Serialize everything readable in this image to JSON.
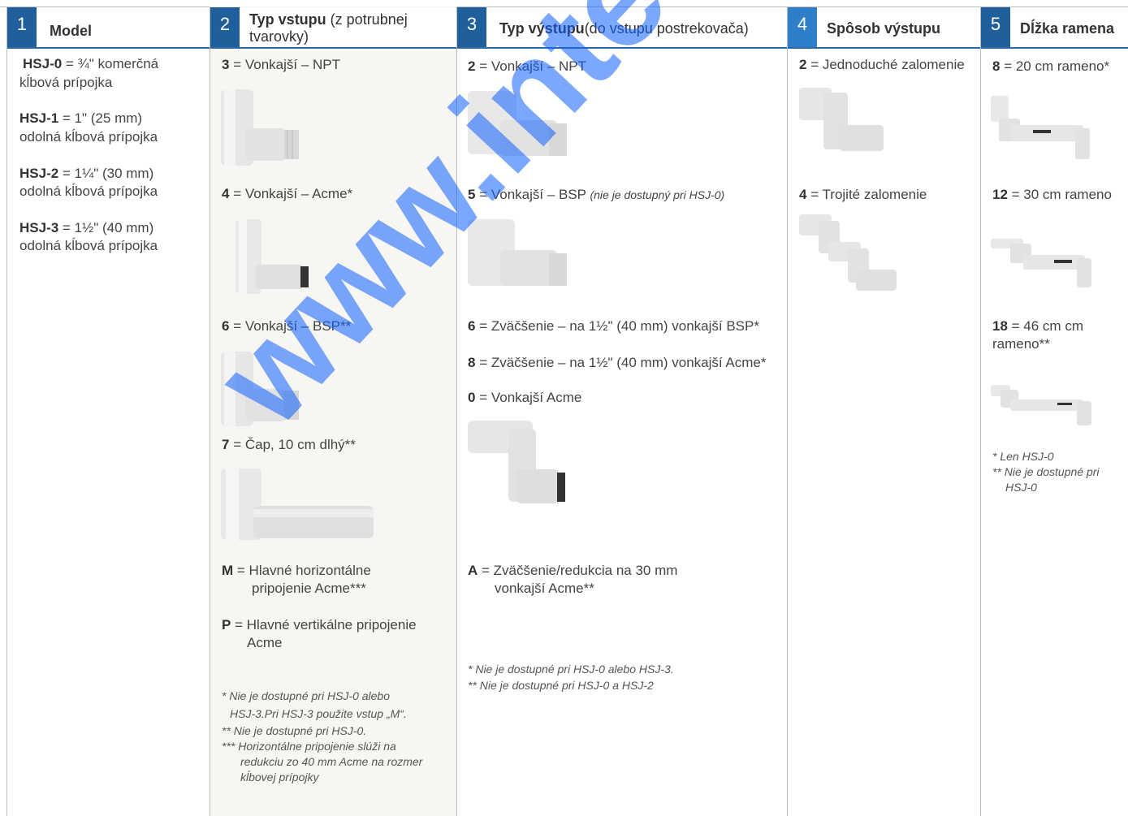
{
  "watermark": "www.intersad.sk",
  "columns": [
    {
      "number": "1",
      "title": "Model",
      "subtitle": ""
    },
    {
      "number": "2",
      "title": "Typ vstupu",
      "subtitle": " (z potrubnej tvarovky)"
    },
    {
      "number": "3",
      "title": "Typ výstupu",
      "subtitle": " (do vstupu postrekovača)"
    },
    {
      "number": "4",
      "title": "Spôsob výstupu",
      "subtitle": ""
    },
    {
      "number": "5",
      "title": "Dĺžka ramena",
      "subtitle": ""
    }
  ],
  "model": [
    {
      "code": "HSJ-0",
      "line1": " = ¾\" komerčná",
      "line2": "kĺbová prípojka"
    },
    {
      "code": "HSJ-1",
      "line1": " = 1\" (25 mm)",
      "line2": "odolná kĺbová prípojka"
    },
    {
      "code": "HSJ-2",
      "line1": " = 1¼\" (30 mm)",
      "line2": "odolná kĺbová prípojka"
    },
    {
      "code": "HSJ-3",
      "line1": " = 1½\" (40 mm)",
      "line2": "odolná kĺbová prípojka"
    }
  ],
  "inlet": {
    "items": [
      {
        "code": "3",
        "text": " = Vonkajší – NPT"
      },
      {
        "code": "4",
        "text": " = Vonkajší – Acme*"
      },
      {
        "code": "6",
        "text": " = Vonkajší – BSP**"
      },
      {
        "code": "7",
        "text": " = Čap, 10 cm dlhý**"
      }
    ],
    "M": {
      "code": "M",
      "line1": " = Hlavné horizontálne",
      "line2": "pripojenie Acme***"
    },
    "P": {
      "code": "P",
      "line1": " = Hlavné vertikálne pripojenie",
      "line2": "Acme"
    },
    "notes": [
      "* Nie je dostupné pri HSJ-0 alebo",
      "HSJ-3.Pri HSJ-3 použite vstup „M“.",
      "** Nie je dostupné pri HSJ-0.",
      "*** Horizontálne pripojenie slúži na",
      "redukciu zo 40 mm Acme na rozmer",
      "kĺbovej prípojky"
    ]
  },
  "outlet": {
    "items": [
      {
        "code": "2",
        "text": " = Vonkajší – NPT"
      },
      {
        "code": "5",
        "text": " = Vonkajší – BSP ",
        "note": "(nie je dostupný pri HSJ-0)"
      },
      {
        "code": "6",
        "text": " = Zväčšenie – na 1½\" (40 mm) vonkajší BSP*"
      },
      {
        "code": "8",
        "text": " = Zväčšenie – na 1½\" (40 mm) vonkajší Acme*"
      },
      {
        "code": "0",
        "text": " = Vonkajší Acme"
      }
    ],
    "A": {
      "code": "A",
      "line1": " = Zväčšenie/redukcia na 30 mm",
      "line2": "vonkajší Acme**"
    },
    "notes": [
      "* Nie je dostupné pri HSJ-0 alebo HSJ-3.",
      "** Nie je dostupné pri HSJ-0 a HSJ-2"
    ]
  },
  "style": {
    "items": [
      {
        "code": "2",
        "text": " = Jednoduché zalomenie"
      },
      {
        "code": "4",
        "text": " = Trojité zalomenie"
      }
    ]
  },
  "arm": {
    "items": [
      {
        "code": "8",
        "text": " = 20 cm rameno*"
      },
      {
        "code": "12",
        "text": " = 30 cm rameno"
      },
      {
        "code": "18",
        "text": " = 46 cm cm",
        "line2": "rameno**"
      }
    ],
    "notes": [
      "* Len HSJ-0",
      "** Nie je dostupné pri",
      "HSJ-0"
    ]
  },
  "colors": {
    "accent": "#1f5f9c",
    "watermark": "#1060ff",
    "shade": "#f7f6f2"
  }
}
